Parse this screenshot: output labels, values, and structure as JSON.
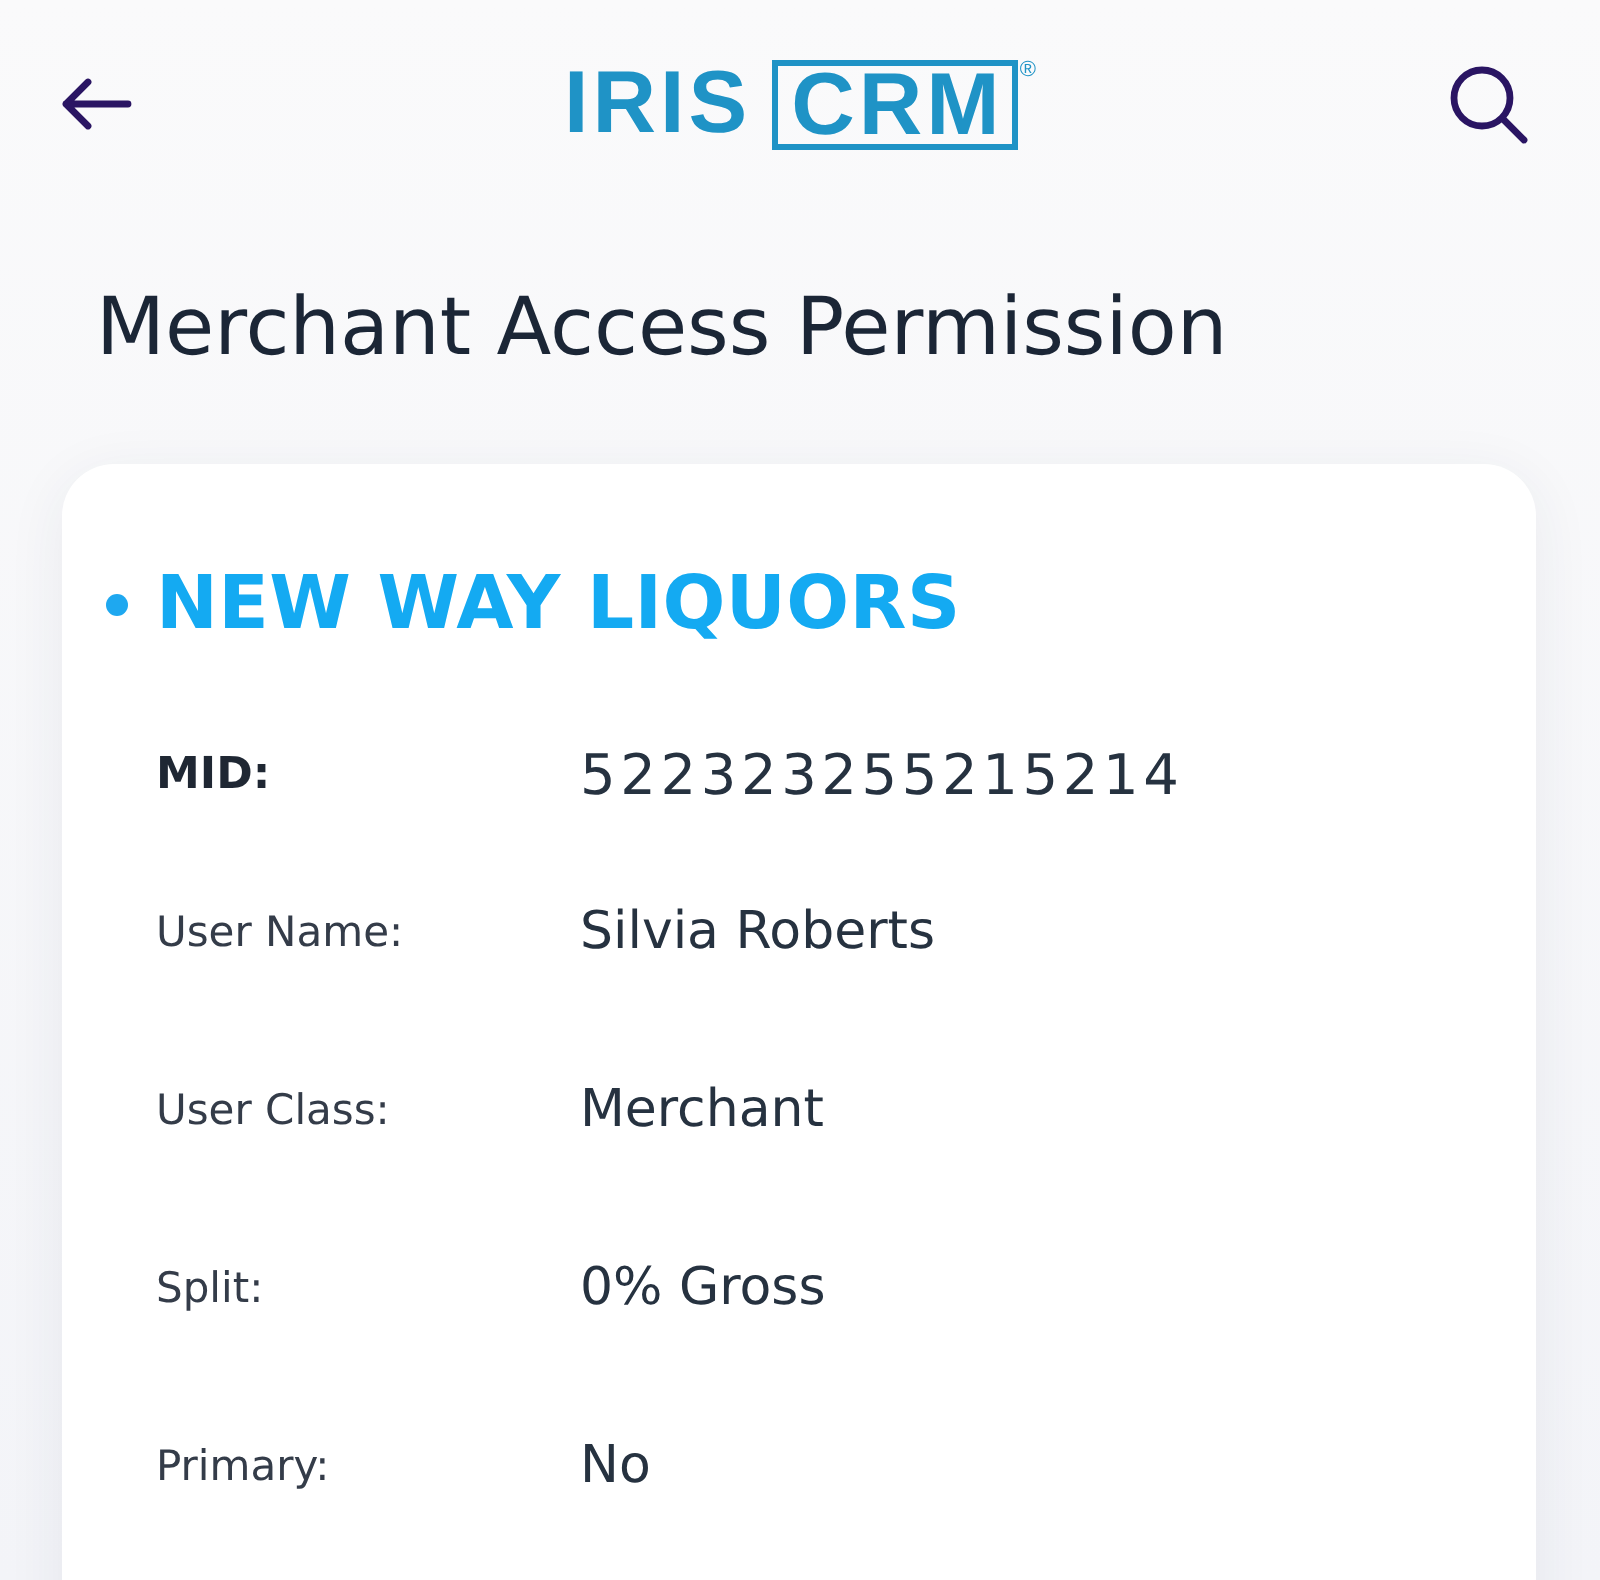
{
  "header": {
    "logo": {
      "word": "IRIS",
      "boxed": "CRM",
      "mark": "®"
    }
  },
  "page": {
    "title": "Merchant Access Permission"
  },
  "card": {
    "name": "NEW WAY LIQUORS",
    "rows": [
      {
        "kind": "id",
        "label": "MID:",
        "value": "522323255215214"
      },
      {
        "kind": "text",
        "label": "User Name:",
        "value": "Silvia Roberts"
      },
      {
        "kind": "text",
        "label": "User Class:",
        "value": "Merchant"
      },
      {
        "kind": "text",
        "label": "Split:",
        "value": "0% Gross"
      },
      {
        "kind": "text",
        "label": "Primary:",
        "value": "No"
      }
    ]
  }
}
